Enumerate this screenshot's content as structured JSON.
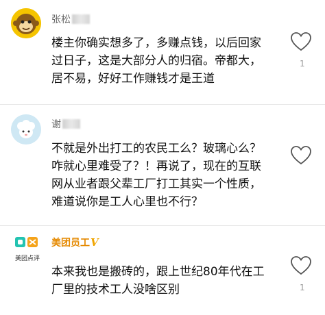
{
  "comments": [
    {
      "username": "张松",
      "text": "楼主你确实想多了，多赚点钱，以后回家\n过日子，这是大部分人的归宿。帝都大，\n居不易，好好工作赚钱才是王道",
      "likes": "1",
      "avatar_icon": "monkey-face-icon"
    },
    {
      "username": "谢",
      "text": "不就是外出打工的农民工么？玻璃心么？\n咋就心里难受了？！再说了，现在的互联\n网从业者跟父辈工厂打工其实一个性质，\n难道说你是工人心里也不行？",
      "likes": "",
      "avatar_icon": "sheep-icon"
    },
    {
      "username": "美团员工",
      "badge": "V",
      "avatar_label": "美团点评",
      "text": "本来我也是搬砖的，跟上世纪80年代在工\n厂里的技术工人没啥区别",
      "likes": "1",
      "avatar_icon": "meituan-logo-icon"
    }
  ],
  "colors": {
    "brand": "#e58900",
    "badge": "#f0a500"
  }
}
